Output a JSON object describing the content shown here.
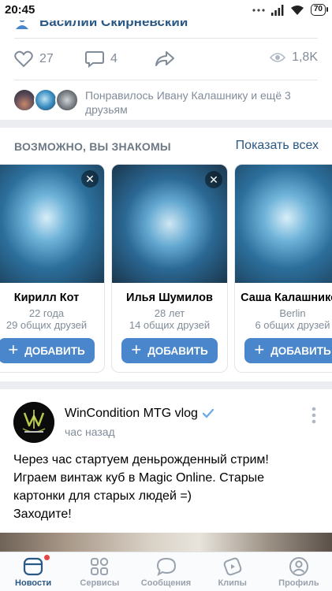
{
  "status_bar": {
    "time": "20:45",
    "battery": "70"
  },
  "prev_post": {
    "author": "Василий Скирневский",
    "likes": "27",
    "comments": "4",
    "views": "1,8K",
    "liked_by": "Понравилось Ивану Калашнику и ещё 3 друзьям"
  },
  "pymk": {
    "title": "ВОЗМОЖНО, ВЫ ЗНАКОМЫ",
    "show_all": "Показать всех",
    "add_label": "ДОБАВИТЬ",
    "cards": [
      {
        "name": "Кирилл Кот",
        "line1": "22 года",
        "line2": "29 общих друзей"
      },
      {
        "name": "Илья Шумилов",
        "line1": "28 лет",
        "line2": "14 общих друзей"
      },
      {
        "name": "Саша Калашников",
        "line1": "Berlin",
        "line2": "6 общих друзей"
      }
    ]
  },
  "post": {
    "group_name": "WinCondition MTG vlog",
    "time": "час назад",
    "avatar_text": "WINCONDITION",
    "lines": [
      "Через час стартуем деньрожденный стрим!",
      "Играем винтаж куб в Magic Online. Старые",
      "картонки для старых людей =)",
      "Заходите!"
    ]
  },
  "tabs": [
    {
      "label": "Новости",
      "icon": "news-icon"
    },
    {
      "label": "Сервисы",
      "icon": "services-icon"
    },
    {
      "label": "Сообщения",
      "icon": "messages-icon"
    },
    {
      "label": "Клипы",
      "icon": "clips-icon"
    },
    {
      "label": "Профиль",
      "icon": "profile-icon"
    }
  ],
  "colors": {
    "link": "#2a5885",
    "button": "#4986cc",
    "secondary": "#818c99"
  }
}
